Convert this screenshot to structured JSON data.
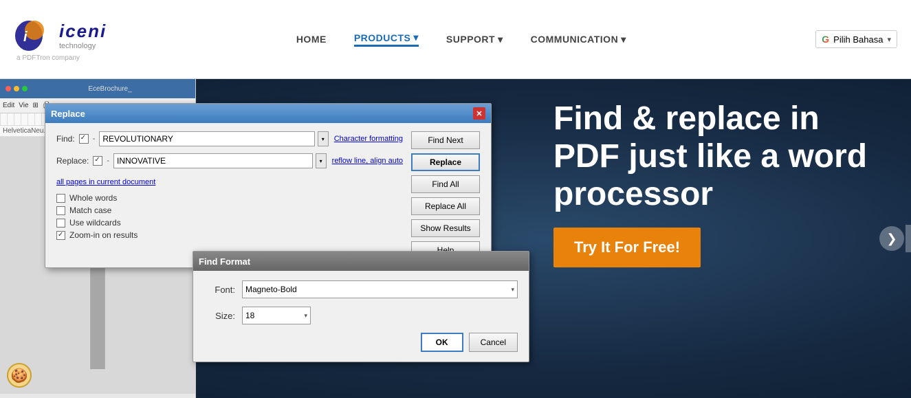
{
  "header": {
    "logo_name": "iceni",
    "logo_tech": "technology",
    "logo_sub": "a PDFTron company",
    "lang_label": "Pilih Bahasa",
    "nav": {
      "home": "HOME",
      "products": "PRODUCTS",
      "support": "SUPPORT",
      "communication": "COMMUNICATION"
    }
  },
  "replace_dialog": {
    "title": "Replace",
    "close": "✕",
    "find_label": "Find:",
    "find_value": "REVOLUTIONARY",
    "replace_label": "Replace:",
    "replace_value": "INNOVATIVE",
    "char_format_link": "Character formatting",
    "reflow_link": "reflow line, align auto",
    "scope_link": "all pages in current document",
    "checkboxes": [
      {
        "label": "Whole words",
        "checked": false
      },
      {
        "label": "Match case",
        "checked": false
      },
      {
        "label": "Use wildcards",
        "checked": false
      },
      {
        "label": "Zoom-in on results",
        "checked": true
      }
    ],
    "buttons": {
      "find_next": "Find Next",
      "replace": "Replace",
      "find_all": "Find All",
      "replace_all": "Replace All",
      "show_results": "Show Results",
      "help": "Help"
    }
  },
  "find_format_dialog": {
    "title": "Find Format",
    "font_label": "Font:",
    "font_value": "Magneto-Bold",
    "size_label": "Size:",
    "size_value": "18",
    "ok_label": "OK",
    "cancel_label": "Cancel"
  },
  "hero": {
    "heading": "Find & replace in PDF just like a word processor",
    "cta": "Try It For Free!"
  },
  "nav_arrows": {
    "left": "❮",
    "right": "❯"
  },
  "cookie_icon": "🍪"
}
